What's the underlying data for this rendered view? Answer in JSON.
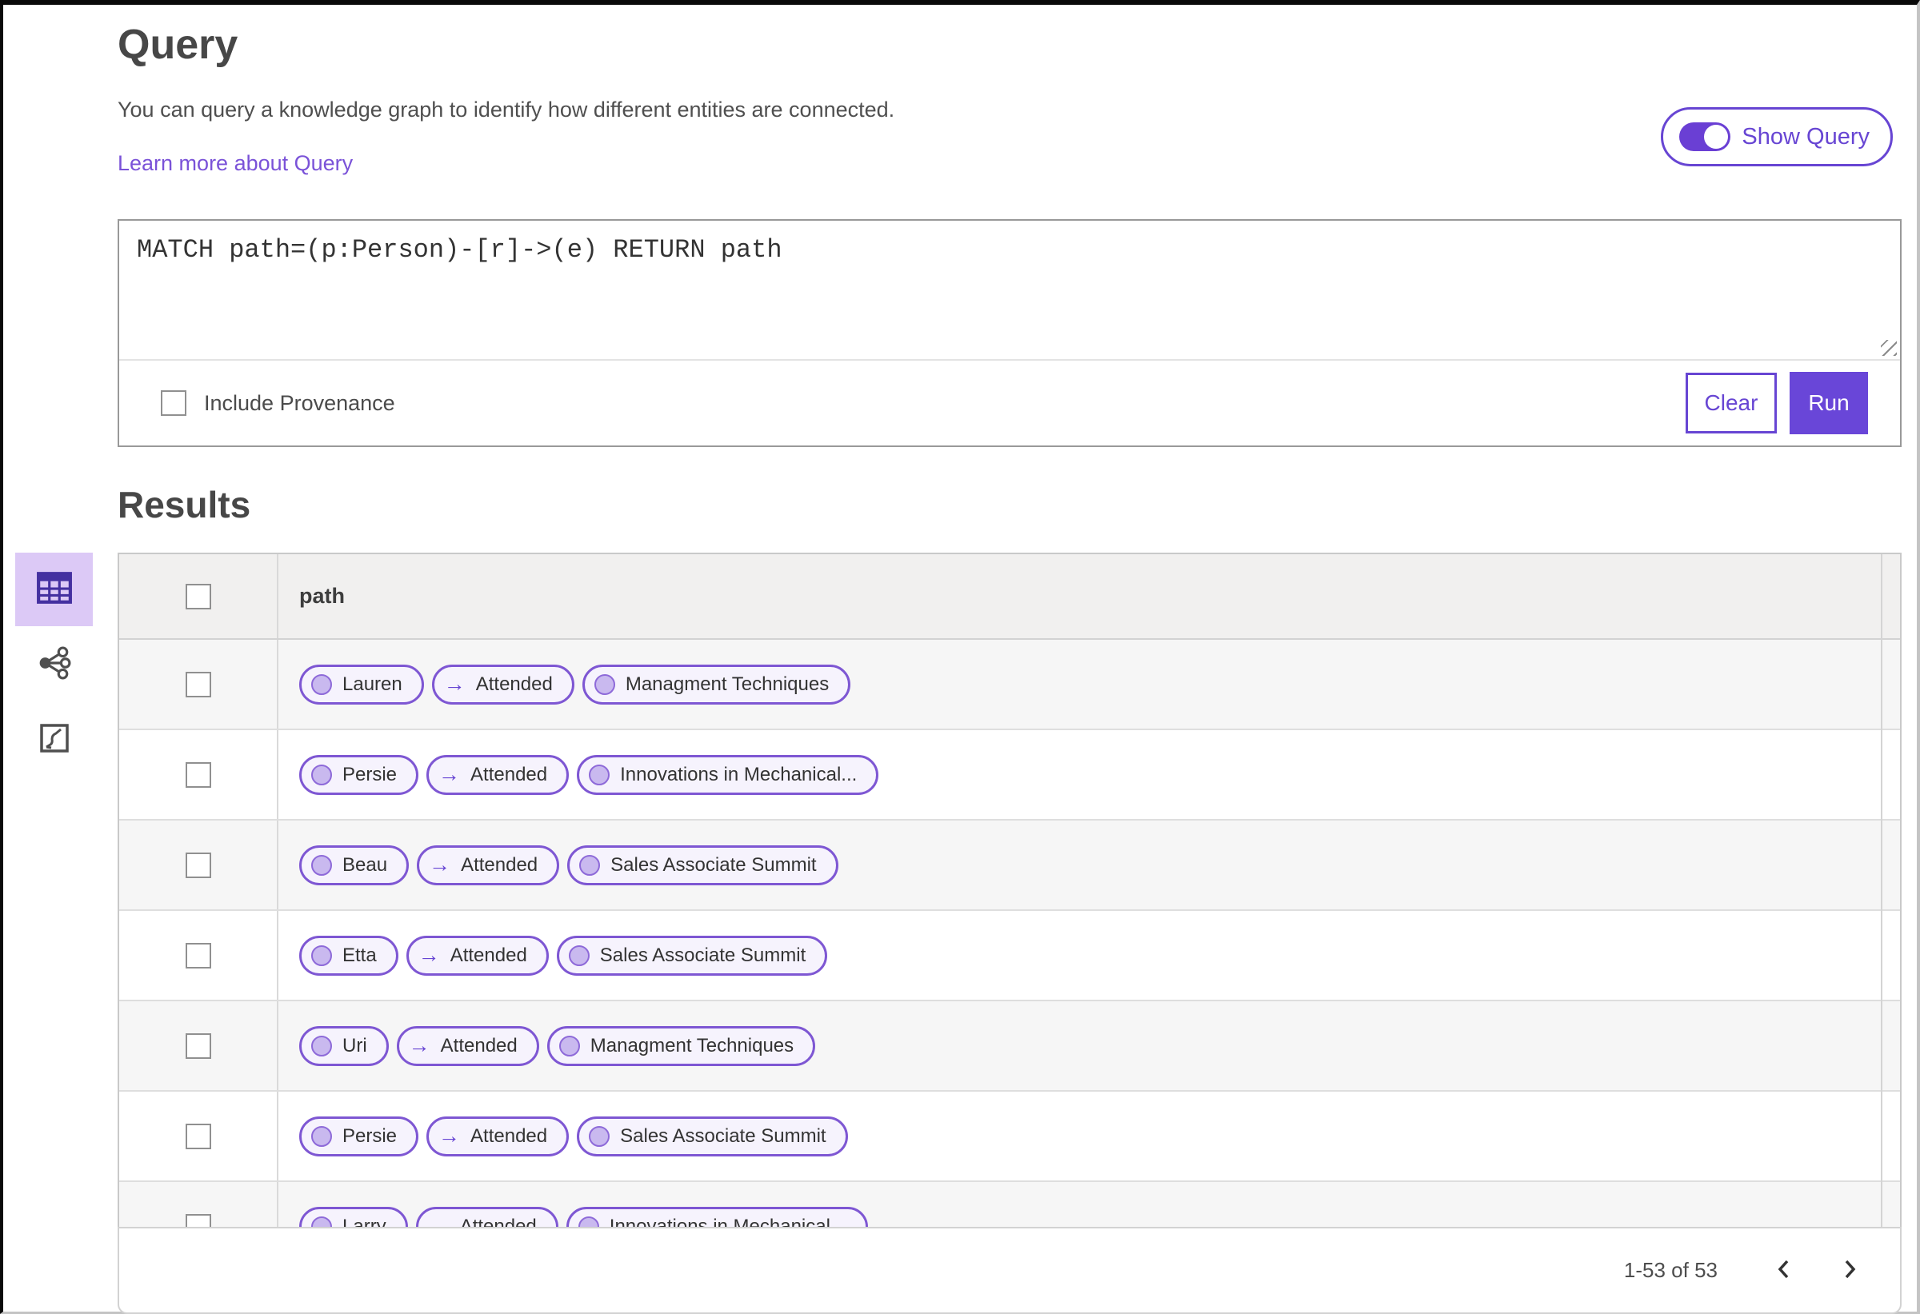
{
  "query_panel": {
    "title": "Query",
    "description": "You can query a knowledge graph to identify how different entities are connected.",
    "learn_more_link": "Learn more about Query",
    "show_query_toggle": {
      "label": "Show Query",
      "state": "on"
    },
    "query_input": {
      "value": "MATCH path=(p:Person)-[r]->(e) RETURN path"
    },
    "include_provenance": {
      "label": "Include Provenance",
      "checked": false
    },
    "buttons": {
      "clear": "Clear",
      "run": "Run"
    }
  },
  "results": {
    "title": "Results",
    "view_toggles": [
      {
        "icon": "table-view-icon",
        "selected": true
      },
      {
        "icon": "graph-view-icon",
        "selected": false
      },
      {
        "icon": "chart-view-icon",
        "selected": false
      }
    ],
    "table": {
      "column_header": "path",
      "rows": [
        {
          "pills": [
            {
              "type": "node",
              "label": "Lauren"
            },
            {
              "type": "edge",
              "label": "Attended"
            },
            {
              "type": "node",
              "label": "Managment Techniques"
            }
          ]
        },
        {
          "pills": [
            {
              "type": "node",
              "label": "Persie"
            },
            {
              "type": "edge",
              "label": "Attended"
            },
            {
              "type": "node",
              "label": "Innovations in Mechanical..."
            }
          ]
        },
        {
          "pills": [
            {
              "type": "node",
              "label": "Beau"
            },
            {
              "type": "edge",
              "label": "Attended"
            },
            {
              "type": "node",
              "label": "Sales Associate Summit"
            }
          ]
        },
        {
          "pills": [
            {
              "type": "node",
              "label": "Etta"
            },
            {
              "type": "edge",
              "label": "Attended"
            },
            {
              "type": "node",
              "label": "Sales Associate Summit"
            }
          ]
        },
        {
          "pills": [
            {
              "type": "node",
              "label": "Uri"
            },
            {
              "type": "edge",
              "label": "Attended"
            },
            {
              "type": "node",
              "label": "Managment Techniques"
            }
          ]
        },
        {
          "pills": [
            {
              "type": "node",
              "label": "Persie"
            },
            {
              "type": "edge",
              "label": "Attended"
            },
            {
              "type": "node",
              "label": "Sales Associate Summit"
            }
          ]
        },
        {
          "pills": [
            {
              "type": "node",
              "label": "Larry"
            },
            {
              "type": "edge",
              "label": "Attended"
            },
            {
              "type": "node",
              "label": "Innovations in Mechanical..."
            }
          ]
        }
      ]
    },
    "pagination": {
      "range_label": "1-53 of 53"
    }
  },
  "colors": {
    "accent": "#6745d3",
    "accent_light": "#dcc9f6",
    "pill_background": "#f6f3fd",
    "link": "#7a52d8"
  }
}
